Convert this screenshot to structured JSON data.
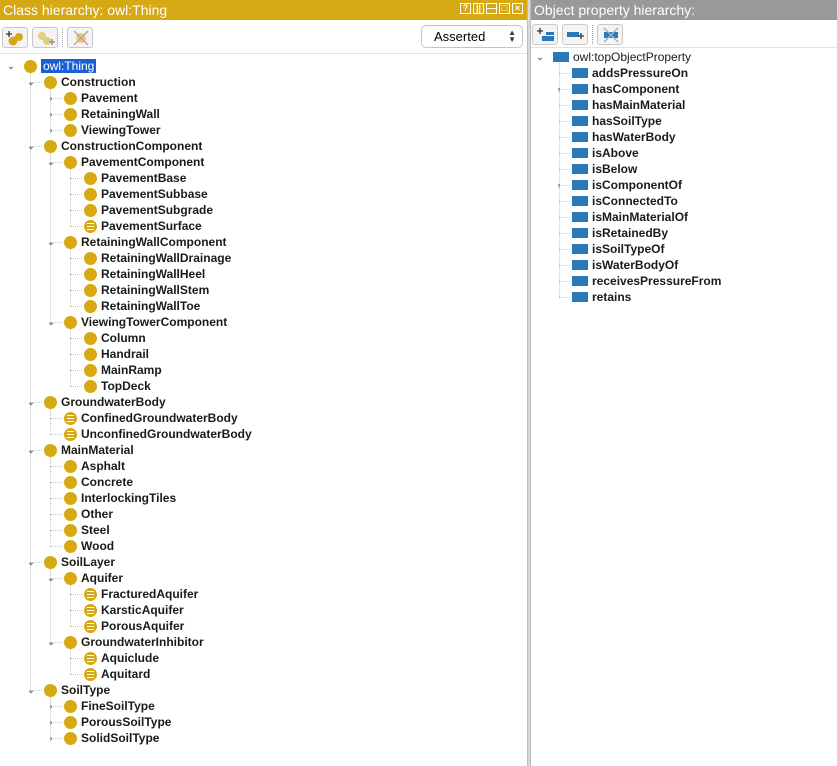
{
  "class_panel": {
    "title": "Class hierarchy: owl:Thing",
    "controls": [
      "?",
      "||",
      "—",
      "□",
      "×"
    ],
    "mode_select": "Asserted",
    "root": "owl:Thing",
    "items": [
      {
        "label": "Construction",
        "depth": 1,
        "toggle": "open",
        "defined": false
      },
      {
        "label": "Pavement",
        "depth": 2,
        "toggle": "closed",
        "defined": false
      },
      {
        "label": "RetainingWall",
        "depth": 2,
        "toggle": "closed",
        "defined": false
      },
      {
        "label": "ViewingTower",
        "depth": 2,
        "toggle": "closed",
        "defined": false
      },
      {
        "label": "ConstructionComponent",
        "depth": 1,
        "toggle": "open",
        "defined": false
      },
      {
        "label": "PavementComponent",
        "depth": 2,
        "toggle": "open",
        "defined": false
      },
      {
        "label": "PavementBase",
        "depth": 3,
        "toggle": "none",
        "defined": false
      },
      {
        "label": "PavementSubbase",
        "depth": 3,
        "toggle": "none",
        "defined": false
      },
      {
        "label": "PavementSubgrade",
        "depth": 3,
        "toggle": "none",
        "defined": false
      },
      {
        "label": "PavementSurface",
        "depth": 3,
        "toggle": "none",
        "defined": true
      },
      {
        "label": "RetainingWallComponent",
        "depth": 2,
        "toggle": "open",
        "defined": false
      },
      {
        "label": "RetainingWallDrainage",
        "depth": 3,
        "toggle": "none",
        "defined": false
      },
      {
        "label": "RetainingWallHeel",
        "depth": 3,
        "toggle": "none",
        "defined": false
      },
      {
        "label": "RetainingWallStem",
        "depth": 3,
        "toggle": "none",
        "defined": false
      },
      {
        "label": "RetainingWallToe",
        "depth": 3,
        "toggle": "none",
        "defined": false
      },
      {
        "label": "ViewingTowerComponent",
        "depth": 2,
        "toggle": "open",
        "defined": false
      },
      {
        "label": "Column",
        "depth": 3,
        "toggle": "none",
        "defined": false
      },
      {
        "label": "Handrail",
        "depth": 3,
        "toggle": "none",
        "defined": false
      },
      {
        "label": "MainRamp",
        "depth": 3,
        "toggle": "none",
        "defined": false
      },
      {
        "label": "TopDeck",
        "depth": 3,
        "toggle": "none",
        "defined": false
      },
      {
        "label": "GroundwaterBody",
        "depth": 1,
        "toggle": "open",
        "defined": false
      },
      {
        "label": "ConfinedGroundwaterBody",
        "depth": 2,
        "toggle": "none",
        "defined": true
      },
      {
        "label": "UnconfinedGroundwaterBody",
        "depth": 2,
        "toggle": "none",
        "defined": true
      },
      {
        "label": "MainMaterial",
        "depth": 1,
        "toggle": "open",
        "defined": false
      },
      {
        "label": "Asphalt",
        "depth": 2,
        "toggle": "none",
        "defined": false
      },
      {
        "label": "Concrete",
        "depth": 2,
        "toggle": "none",
        "defined": false
      },
      {
        "label": "InterlockingTiles",
        "depth": 2,
        "toggle": "none",
        "defined": false
      },
      {
        "label": "Other",
        "depth": 2,
        "toggle": "none",
        "defined": false
      },
      {
        "label": "Steel",
        "depth": 2,
        "toggle": "none",
        "defined": false
      },
      {
        "label": "Wood",
        "depth": 2,
        "toggle": "none",
        "defined": false
      },
      {
        "label": "SoilLayer",
        "depth": 1,
        "toggle": "open",
        "defined": false
      },
      {
        "label": "Aquifer",
        "depth": 2,
        "toggle": "open",
        "defined": false
      },
      {
        "label": "FracturedAquifer",
        "depth": 3,
        "toggle": "none",
        "defined": true
      },
      {
        "label": "KarsticAquifer",
        "depth": 3,
        "toggle": "none",
        "defined": true
      },
      {
        "label": "PorousAquifer",
        "depth": 3,
        "toggle": "none",
        "defined": true
      },
      {
        "label": "GroundwaterInhibitor",
        "depth": 2,
        "toggle": "open",
        "defined": false
      },
      {
        "label": "Aquiclude",
        "depth": 3,
        "toggle": "none",
        "defined": true
      },
      {
        "label": "Aquitard",
        "depth": 3,
        "toggle": "none",
        "defined": true
      },
      {
        "label": "SoilType",
        "depth": 1,
        "toggle": "open",
        "defined": false
      },
      {
        "label": "FineSoilType",
        "depth": 2,
        "toggle": "closed",
        "defined": false
      },
      {
        "label": "PorousSoilType",
        "depth": 2,
        "toggle": "closed",
        "defined": false
      },
      {
        "label": "SolidSoilType",
        "depth": 2,
        "toggle": "closed",
        "defined": false
      }
    ]
  },
  "property_panel": {
    "title": "Object property hierarchy:",
    "root": "owl:topObjectProperty",
    "items": [
      {
        "label": "addsPressureOn",
        "toggle": "none"
      },
      {
        "label": "hasComponent",
        "toggle": "closed"
      },
      {
        "label": "hasMainMaterial",
        "toggle": "none"
      },
      {
        "label": "hasSoilType",
        "toggle": "none"
      },
      {
        "label": "hasWaterBody",
        "toggle": "none"
      },
      {
        "label": "isAbove",
        "toggle": "none"
      },
      {
        "label": "isBelow",
        "toggle": "none"
      },
      {
        "label": "isComponentOf",
        "toggle": "closed"
      },
      {
        "label": "isConnectedTo",
        "toggle": "none"
      },
      {
        "label": "isMainMaterialOf",
        "toggle": "none"
      },
      {
        "label": "isRetainedBy",
        "toggle": "none"
      },
      {
        "label": "isSoilTypeOf",
        "toggle": "none"
      },
      {
        "label": "isWaterBodyOf",
        "toggle": "none"
      },
      {
        "label": "receivesPressureFrom",
        "toggle": "none"
      },
      {
        "label": "retains",
        "toggle": "none"
      }
    ]
  },
  "colors": {
    "class_accent": "#d5a814",
    "property_accent": "#2b78b8",
    "selection": "#1b5fd1"
  }
}
